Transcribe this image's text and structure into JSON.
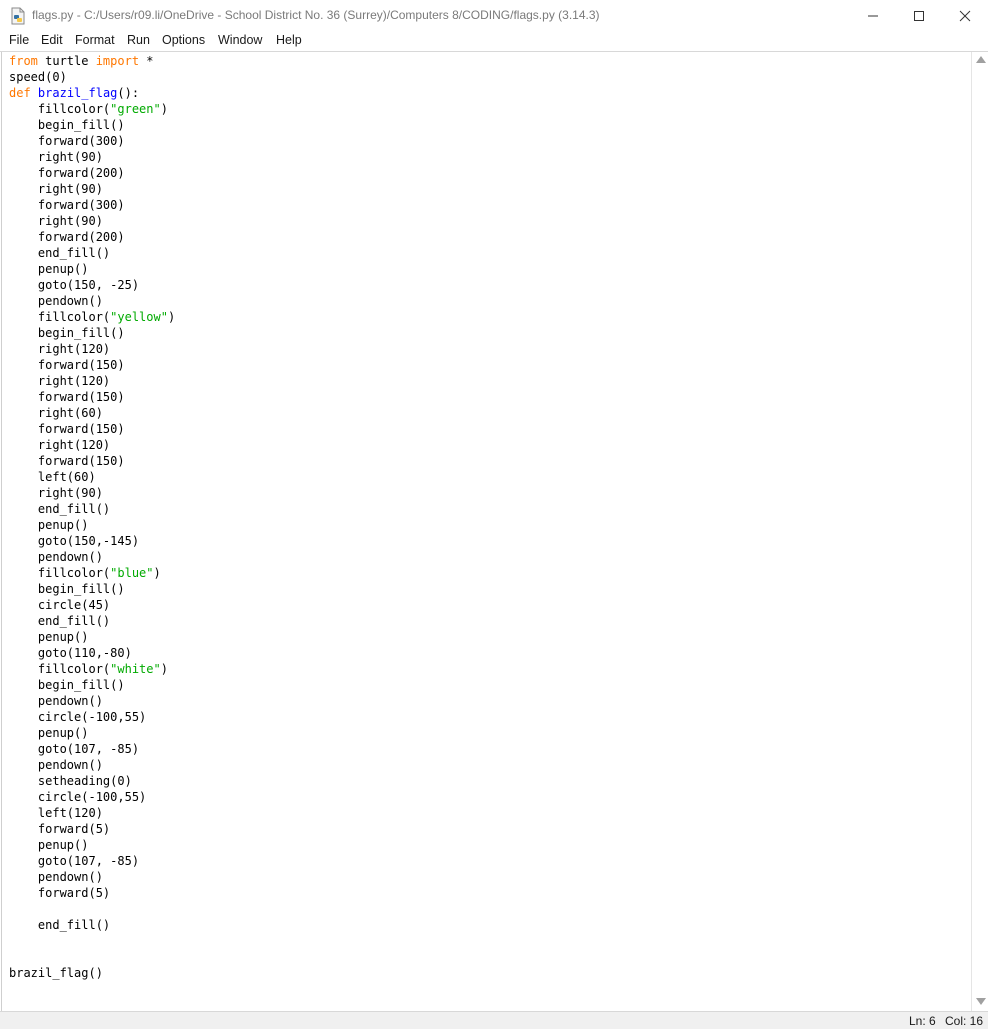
{
  "window": {
    "title": "flags.py - C:/Users/r09.li/OneDrive - School District No. 36 (Surrey)/Computers 8/CODING/flags.py (3.14.3)"
  },
  "menu": [
    "File",
    "Edit",
    "Format",
    "Run",
    "Options",
    "Window",
    "Help"
  ],
  "colors": {
    "keyword": "#ff7700",
    "definition": "#0000ff",
    "string": "#00aa00",
    "text": "#000000"
  },
  "code_lines": [
    "from turtle import *",
    "speed(0)",
    "def brazil_flag():",
    "    fillcolor(\"green\")",
    "    begin_fill()",
    "    forward(300)",
    "    right(90)",
    "    forward(200)",
    "    right(90)",
    "    forward(300)",
    "    right(90)",
    "    forward(200)",
    "    end_fill()",
    "    penup()",
    "    goto(150, -25)",
    "    pendown()",
    "    fillcolor(\"yellow\")",
    "    begin_fill()",
    "    right(120)",
    "    forward(150)",
    "    right(120)",
    "    forward(150)",
    "    right(60)",
    "    forward(150)",
    "    right(120)",
    "    forward(150)",
    "    left(60)",
    "    right(90)",
    "    end_fill()",
    "    penup()",
    "    goto(150,-145)",
    "    pendown()",
    "    fillcolor(\"blue\")",
    "    begin_fill()",
    "    circle(45)",
    "    end_fill()",
    "    penup()",
    "    goto(110,-80)",
    "    fillcolor(\"white\")",
    "    begin_fill()",
    "    pendown()",
    "    circle(-100,55)",
    "    penup()",
    "    goto(107, -85)",
    "    pendown()",
    "    setheading(0)",
    "    circle(-100,55)",
    "    left(120)",
    "    forward(5)",
    "    penup()",
    "    goto(107, -85)",
    "    pendown()",
    "    forward(5)",
    "",
    "    end_fill()",
    "",
    "",
    "brazil_flag()"
  ],
  "status": {
    "line": "Ln: 6",
    "col": "Col: 16"
  }
}
